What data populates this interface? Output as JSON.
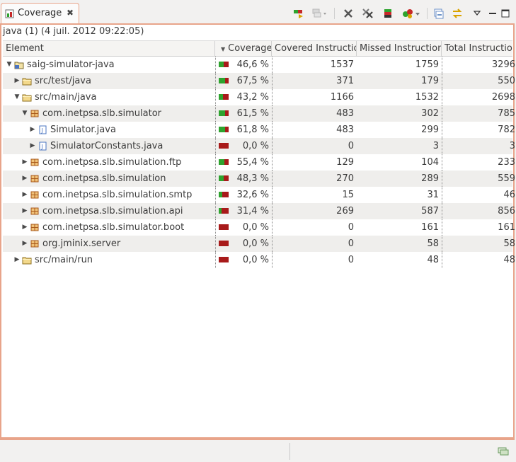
{
  "view": {
    "tab_label": "Coverage",
    "tab_close": "✖",
    "session_description": "java (1) (4 juil. 2012 09:22:05)"
  },
  "columns": {
    "element": "Element",
    "sort_indicator": "▼",
    "coverage": "Coverage",
    "covered": "Covered Instructions",
    "missed": "Missed Instructions",
    "total": "Total Instructions"
  },
  "rows": [
    {
      "name": "saig-simulator-java",
      "type": "project",
      "level": 0,
      "expander": "▼",
      "coverage": "46,6 %",
      "covered": "1537",
      "missed": "1759",
      "total": "3296",
      "cov_fraction": 0.466
    },
    {
      "name": "src/test/java",
      "type": "folder",
      "level": 1,
      "expander": "▶",
      "coverage": "67,5 %",
      "covered": "371",
      "missed": "179",
      "total": "550",
      "cov_fraction": 0.675
    },
    {
      "name": "src/main/java",
      "type": "folder",
      "level": 1,
      "expander": "▼",
      "coverage": "43,2 %",
      "covered": "1166",
      "missed": "1532",
      "total": "2698",
      "cov_fraction": 0.432
    },
    {
      "name": "com.inetpsa.slb.simulator",
      "type": "package",
      "level": 2,
      "expander": "▼",
      "coverage": "61,5 %",
      "covered": "483",
      "missed": "302",
      "total": "785",
      "cov_fraction": 0.615
    },
    {
      "name": "Simulator.java",
      "type": "file",
      "level": 3,
      "expander": "▶",
      "coverage": "61,8 %",
      "covered": "483",
      "missed": "299",
      "total": "782",
      "cov_fraction": 0.618
    },
    {
      "name": "SimulatorConstants.java",
      "type": "file",
      "level": 3,
      "expander": "▶",
      "coverage": "0,0 %",
      "covered": "0",
      "missed": "3",
      "total": "3",
      "cov_fraction": 0.0
    },
    {
      "name": "com.inetpsa.slb.simulation.ftp",
      "type": "package",
      "level": 2,
      "expander": "▶",
      "coverage": "55,4 %",
      "covered": "129",
      "missed": "104",
      "total": "233",
      "cov_fraction": 0.554
    },
    {
      "name": "com.inetpsa.slb.simulation",
      "type": "package",
      "level": 2,
      "expander": "▶",
      "coverage": "48,3 %",
      "covered": "270",
      "missed": "289",
      "total": "559",
      "cov_fraction": 0.483
    },
    {
      "name": "com.inetpsa.slb.simulation.smtp",
      "type": "package",
      "level": 2,
      "expander": "▶",
      "coverage": "32,6 %",
      "covered": "15",
      "missed": "31",
      "total": "46",
      "cov_fraction": 0.326
    },
    {
      "name": "com.inetpsa.slb.simulation.api",
      "type": "package",
      "level": 2,
      "expander": "▶",
      "coverage": "31,4 %",
      "covered": "269",
      "missed": "587",
      "total": "856",
      "cov_fraction": 0.314
    },
    {
      "name": "com.inetpsa.slb.simulator.boot",
      "type": "package",
      "level": 2,
      "expander": "▶",
      "coverage": "0,0 %",
      "covered": "0",
      "missed": "161",
      "total": "161",
      "cov_fraction": 0.0
    },
    {
      "name": "org.jminix.server",
      "type": "package",
      "level": 2,
      "expander": "▶",
      "coverage": "0,0 %",
      "covered": "0",
      "missed": "58",
      "total": "58",
      "cov_fraction": 0.0
    },
    {
      "name": "src/main/run",
      "type": "folder",
      "level": 1,
      "expander": "▶",
      "coverage": "0,0 %",
      "covered": "0",
      "missed": "48",
      "total": "48",
      "cov_fraction": 0.0
    }
  ],
  "toolbar": [
    "relaunch-icon",
    "merge-sessions-icon",
    "remove-session-icon",
    "remove-all-sessions-icon",
    "dump-execution-data-icon",
    "select-session-icon",
    "collapse-all-icon",
    "link-with-selection-icon",
    "view-menu-icon",
    "minimize-icon",
    "maximize-icon"
  ],
  "colors": {
    "accent_border": "#e8a48a",
    "coverage_green": "#2ea32e",
    "coverage_red": "#a81a1a"
  }
}
